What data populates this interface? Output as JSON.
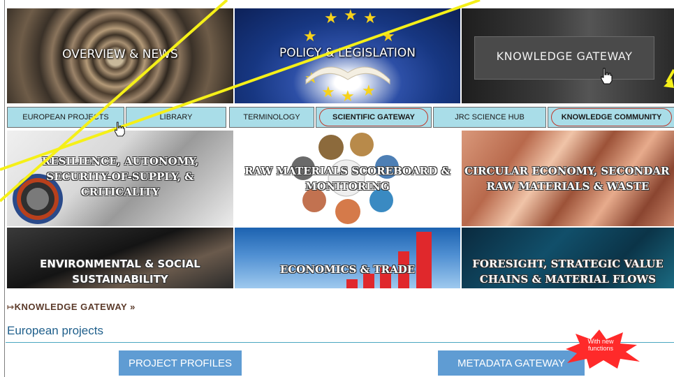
{
  "hero": {
    "overview": "OVERVIEW & NEWS",
    "policy": "POLICY & LEGISLATION",
    "knowledge": "KNOWLEDGE GATEWAY"
  },
  "subnav": {
    "items": [
      {
        "label": "EUROPEAN PROJECTS"
      },
      {
        "label": "LIBRARY"
      },
      {
        "label": "TERMINOLOGY"
      },
      {
        "label": "SCIENTIFIC GATEWAY"
      },
      {
        "label": "JRC SCIENCE HUB"
      },
      {
        "label": "KNOWLEDGE COMMUNITY"
      }
    ]
  },
  "tiles": {
    "resilience": {
      "line1": "RESILIENCE, AUTONOMY,",
      "line2": "SECURITY-OF-SUPPLY, &",
      "line3": "CRITICALITY"
    },
    "scoreboard": {
      "line1": "RAW MATERIALS SCOREBOARD &",
      "line2": "MONITORING"
    },
    "circular": {
      "line1": "CIRCULAR ECONOMY, SECONDAR",
      "line2": "RAW MATERIALS & WASTE"
    },
    "environmental": {
      "line1": "ENVIRONMENTAL & SOCIAL",
      "line2": "SUSTAINABILITY"
    },
    "economics": {
      "line1": "ECONOMICS & TRADE"
    },
    "foresight": {
      "line1": "FORESIGHT, STRATEGIC VALUE",
      "line2": "CHAINS & MATERIAL FLOWS"
    }
  },
  "breadcrumb": {
    "prefix": "↦",
    "label": "KNOWLEDGE GATEWAY",
    "suffix": "»"
  },
  "section": {
    "title": "European projects"
  },
  "buttons": {
    "profiles": "PROJECT PROFILES",
    "metadata": "METADATA GATEWAY"
  },
  "burst": {
    "line1": "With new",
    "line2": "functions"
  },
  "colors": {
    "accent_line": "#f5f018",
    "tab_bg": "#a9dde8",
    "button_bg": "#5f9cd3",
    "oval": "#c0392b",
    "title": "#1f5f8b"
  }
}
